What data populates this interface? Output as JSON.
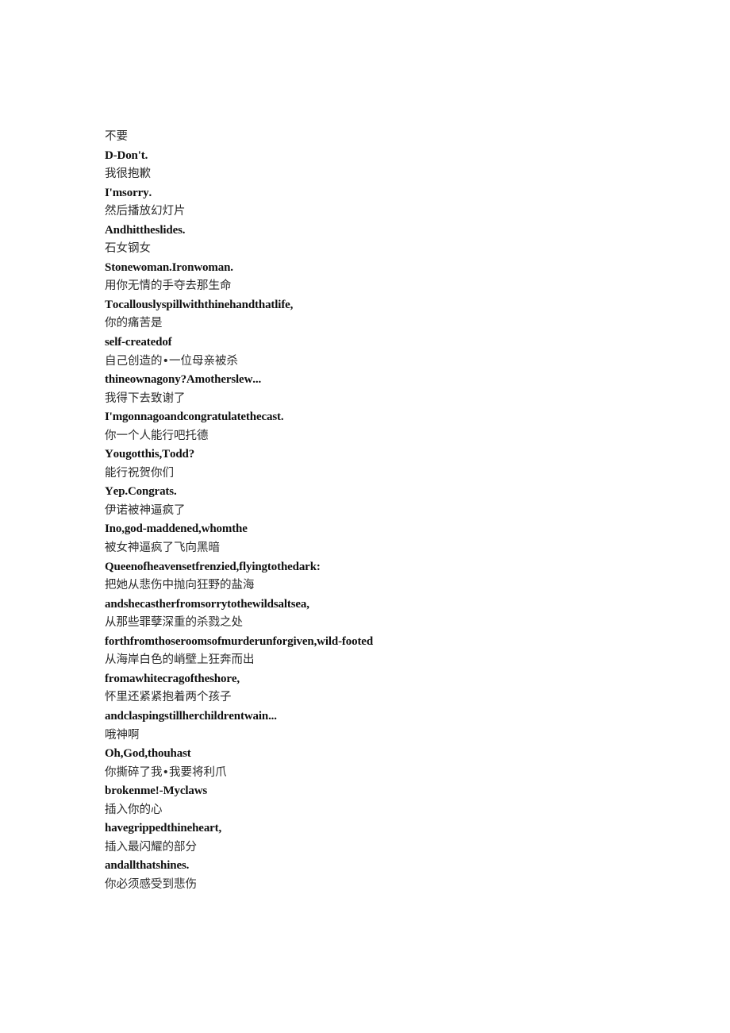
{
  "document": {
    "type": "bilingual-subtitle-transcript",
    "background_color": "#ffffff",
    "text_color_zh": "#2b2b2b",
    "text_color_en": "#101010",
    "lines": [
      {
        "lang": "zh",
        "text": "不要"
      },
      {
        "lang": "en",
        "text": "D-Don't."
      },
      {
        "lang": "zh",
        "text": "我很抱歉"
      },
      {
        "lang": "en",
        "text": "I'msorry."
      },
      {
        "lang": "zh",
        "text": "然后播放幻灯片"
      },
      {
        "lang": "en",
        "text": "Andhittheslides."
      },
      {
        "lang": "zh",
        "text": "石女钢女"
      },
      {
        "lang": "en",
        "text": "Stonewoman.Ironwoman."
      },
      {
        "lang": "zh",
        "text": "用你无情的手夺去那生命"
      },
      {
        "lang": "en",
        "text": "Tocallouslyspillwiththinehandthatlife,"
      },
      {
        "lang": "zh",
        "text": "你的痛苦是"
      },
      {
        "lang": "en",
        "text": "self-createdof"
      },
      {
        "lang": "zh",
        "text": "自己创造的•一位母亲被杀"
      },
      {
        "lang": "en",
        "text": "thineownagony?Amotherslew..."
      },
      {
        "lang": "zh",
        "text": "我得下去致谢了"
      },
      {
        "lang": "en",
        "text": "I'mgonnagoandcongratulatethecast."
      },
      {
        "lang": "zh",
        "text": "你一个人能行吧托德"
      },
      {
        "lang": "en",
        "text": "Yougotthis,Todd?"
      },
      {
        "lang": "zh",
        "text": "能行祝贺你们"
      },
      {
        "lang": "en",
        "text": "Yep.Congrats."
      },
      {
        "lang": "zh",
        "text": "伊诺被神逼疯了"
      },
      {
        "lang": "en",
        "text": "Ino,god-maddened,whomthe"
      },
      {
        "lang": "zh",
        "text": "被女神逼疯了飞向黑暗"
      },
      {
        "lang": "en",
        "text": "Queenofheavensetfrenzied,flyingtothedark:"
      },
      {
        "lang": "zh",
        "text": "把她从悲伤中抛向狂野的盐海"
      },
      {
        "lang": "en",
        "text": "andshecastherfromsorrytothewildsaltsea,"
      },
      {
        "lang": "zh",
        "text": "从那些罪孽深重的杀戮之处"
      },
      {
        "lang": "en",
        "text": "forthfromthoseroomsofmurderunforgiven,wild-footed"
      },
      {
        "lang": "zh",
        "text": "从海岸白色的峭壁上狂奔而出"
      },
      {
        "lang": "en",
        "text": "fromawhitecragoftheshore,"
      },
      {
        "lang": "zh",
        "text": "怀里还紧紧抱着两个孩子"
      },
      {
        "lang": "en",
        "text": "andclaspingstillherchildrentwain..."
      },
      {
        "lang": "zh",
        "text": "哦神啊"
      },
      {
        "lang": "en",
        "text": "Oh,God,thouhast"
      },
      {
        "lang": "zh",
        "text": "你撕碎了我•我要将利爪"
      },
      {
        "lang": "en",
        "text": "brokenme!-Myclaws"
      },
      {
        "lang": "zh",
        "text": "插入你的心"
      },
      {
        "lang": "en",
        "text": "havegrippedthineheart,"
      },
      {
        "lang": "zh",
        "text": "插入最闪耀的部分"
      },
      {
        "lang": "en",
        "text": "andallthatshines."
      },
      {
        "lang": "zh",
        "text": "你必须感受到悲伤"
      }
    ]
  }
}
